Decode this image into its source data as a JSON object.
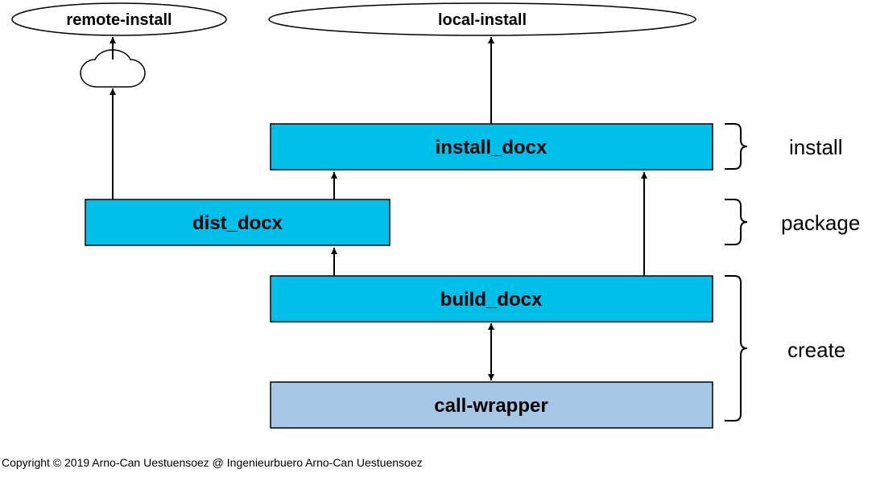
{
  "nodes": {
    "remote_install": "remote-install",
    "local_install": "local-install",
    "install_docx": "install_docx",
    "dist_docx": "dist_docx",
    "build_docx": "build_docx",
    "call_wrapper": "call-wrapper"
  },
  "groups": {
    "install": "install",
    "package": "package",
    "create": "create"
  },
  "copyright": "Copyright © 2019 Arno-Can Uestuensoez @ Ingenieurbuero Arno-Can Uestuensoez"
}
